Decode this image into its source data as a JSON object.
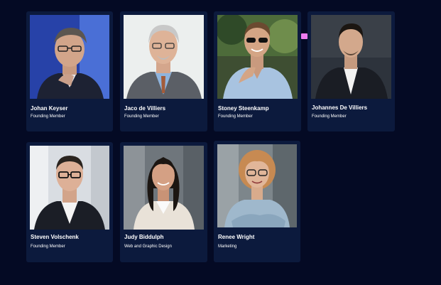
{
  "team": [
    {
      "name": "Johan Keyser",
      "role": "Founding Member",
      "photo_icon": "portrait-man-glasses-thinking-icon"
    },
    {
      "name": "Jaco de Villiers",
      "role": "Founding Member",
      "photo_icon": "portrait-man-grey-hair-suit-icon"
    },
    {
      "name": "Stoney Steenkamp",
      "role": "Founding Member",
      "photo_icon": "portrait-man-sunglasses-icon"
    },
    {
      "name": "Johannes De Villiers",
      "role": "Founding Member",
      "photo_icon": "portrait-young-man-suit-icon"
    },
    {
      "name": "Steven Volschenk",
      "role": "Founding Member",
      "photo_icon": "portrait-man-glasses-blazer-icon"
    },
    {
      "name": "Judy Biddulph",
      "role": "Web and Graphic Design",
      "photo_icon": "portrait-woman-dark-hair-icon"
    },
    {
      "name": "Renee Wright",
      "role": "Marketing",
      "photo_icon": "portrait-woman-curly-hair-glasses-icon"
    }
  ],
  "colors": {
    "page_background": "#040a24",
    "card_background": "#0c1a3d",
    "text": "#ffffff",
    "marker": "#ee7cf0"
  }
}
